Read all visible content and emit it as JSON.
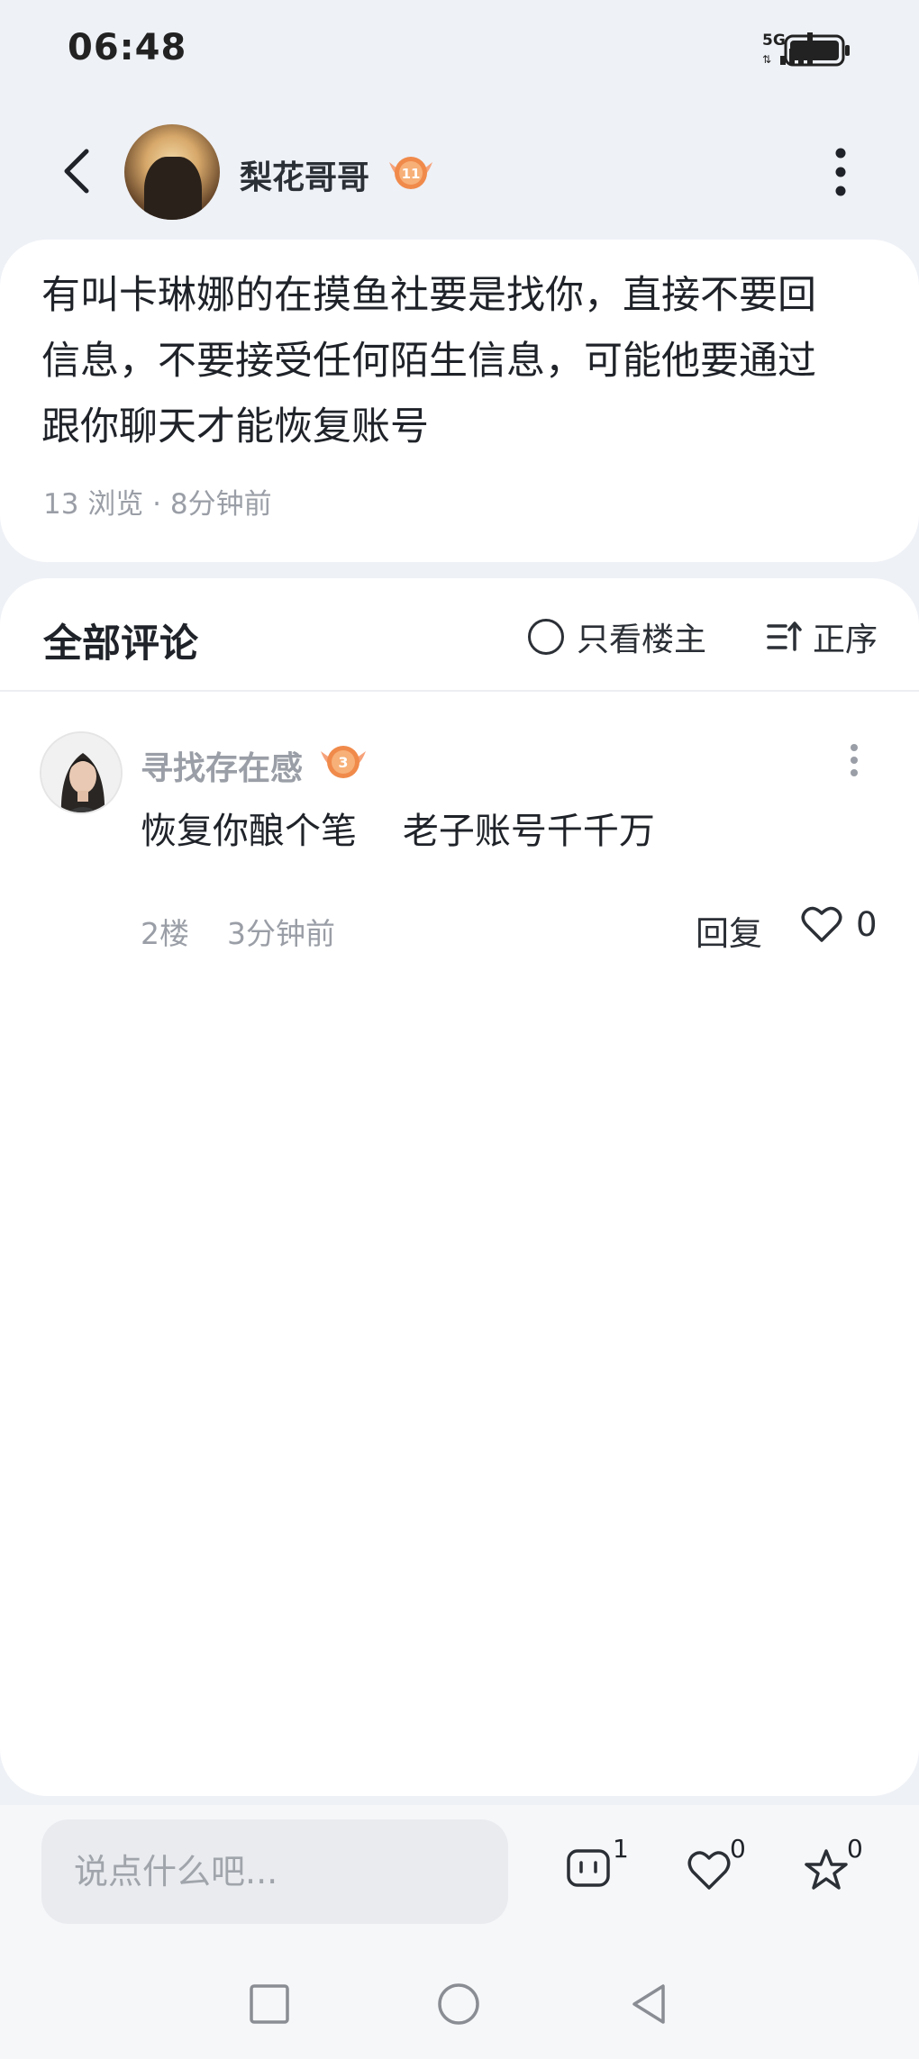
{
  "status_bar": {
    "time": "06:48",
    "network": "5G"
  },
  "post": {
    "author_name": "梨花哥哥",
    "author_level": "11",
    "body": "有叫卡琳娜的在摸鱼社要是找你，直接不要回信息，不要接受任何陌生信息，可能他要通过跟你聊天才能恢复账号",
    "meta": "13 浏览 · 8分钟前"
  },
  "comments_section": {
    "title": "全部评论",
    "filter_owner_label": "只看楼主",
    "sort_label": "正序",
    "comments": [
      {
        "user_name": "寻找存在感",
        "level": "3",
        "text": "恢复你酿个笔    老子账号千千万",
        "meta": "2楼    3分钟前",
        "reply_label": "回复",
        "like_count": "0"
      }
    ]
  },
  "bottom_bar": {
    "input_placeholder": "说点什么吧...",
    "comment_count": "1",
    "like_count": "0",
    "favorite_count": "0"
  },
  "icons": {
    "back": "back-arrow-icon",
    "more": "more-vertical-icon",
    "filter": "radio-circle-icon",
    "sort": "sort-icon",
    "heart": "heart-icon",
    "comment": "comment-icon",
    "star": "star-icon",
    "nav_recent": "square-icon",
    "nav_home": "circle-icon",
    "nav_back": "triangle-back-icon"
  },
  "colors": {
    "background": "#eef1f6",
    "card": "#ffffff",
    "badge_orange": "#f08a4b",
    "muted_text": "#9a9ea6"
  }
}
